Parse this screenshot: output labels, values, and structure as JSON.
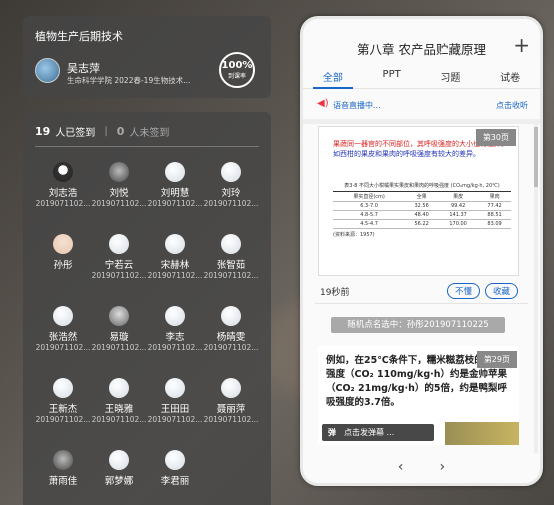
{
  "course": {
    "title": "植物生产后期技术",
    "teacher_name": "吴志萍",
    "teacher_dept": "生命科学学院 2022春-19生物技术...",
    "rate_value": "100%",
    "rate_label": "到课率"
  },
  "signin": {
    "signed_count": "19",
    "signed_label": "人已签到",
    "unsigned_count": "0",
    "unsigned_label": "人未签到"
  },
  "students": [
    {
      "name": "刘志浩",
      "id": "2019071102..."
    },
    {
      "name": "刘悦",
      "id": "2019071102..."
    },
    {
      "name": "刘明慧",
      "id": "2019071102..."
    },
    {
      "name": "刘玲",
      "id": "2019071102..."
    },
    {
      "name": "孙彤",
      "id": "2019071102..."
    },
    {
      "name": "宁若云",
      "id": "2019071102..."
    },
    {
      "name": "宋赫林",
      "id": "2019071102..."
    },
    {
      "name": "张智茹",
      "id": "2019071102..."
    },
    {
      "name": "张浩然",
      "id": "2019071102..."
    },
    {
      "name": "易璇",
      "id": "2019071102..."
    },
    {
      "name": "李志",
      "id": "2019071102..."
    },
    {
      "name": "杨晴雯",
      "id": "2019071102..."
    },
    {
      "name": "王新杰",
      "id": "2019071102..."
    },
    {
      "name": "王晓雅",
      "id": "2019071102..."
    },
    {
      "name": "王田田",
      "id": "2019071102..."
    },
    {
      "name": "聂丽萍",
      "id": "2019071102..."
    },
    {
      "name": "萧雨佳",
      "id": ""
    },
    {
      "name": "郭梦娜",
      "id": ""
    },
    {
      "name": "李君丽",
      "id": ""
    }
  ],
  "phone": {
    "title": "第八章 农产品贮藏原理",
    "tabs": [
      "全部",
      "PPT",
      "习题",
      "试卷"
    ],
    "live_text": "语音直播中...",
    "collapse_label": "点击收听",
    "slide1_page": "第30页",
    "slide1_text_red": "果蔬同一器官的不同部位，其呼吸强度的大小也有差异。",
    "slide1_text_blue": "如西柑的果皮和果肉的呼吸强度有较大的差异。",
    "slide1_table_caption": "表3-8  不同大小柑橘果实果皮和果肉的呼吸强度 (CO₂mg/kg·h, 20℃)",
    "slide1_table": {
      "headers": [
        "果实直径(cm)",
        "全果",
        "果皮",
        "果肉"
      ],
      "rows": [
        [
          "6.3-7.0",
          "32.56",
          "99.42",
          "77.42"
        ],
        [
          "4.8-5.7",
          "48.40",
          "141.37",
          "88.51"
        ],
        [
          "4.5-4.7",
          "56.22",
          "170.00",
          "83.09"
        ]
      ],
      "note": "(资料来源：1957)"
    },
    "time_ago": "19秒前",
    "btn_unclear": "不懂",
    "btn_favorite": "收藏",
    "random_pick": "随机点名选中：孙彤201907110225",
    "slide2_page": "第29页",
    "slide2_text_a": "例如，在25℃条件下，糯米糍荔枝的呼吸强度（CO₂ 110mg/kg·h）约是金帅苹果（CO₂ 21mg/kg·h）的5倍，约是鸭梨呼吸强度的3.7倍。",
    "danmu_label": "弹",
    "danmu_text": "点击发弹幕 ...",
    "nav_prev": "‹",
    "nav_next": "›"
  }
}
